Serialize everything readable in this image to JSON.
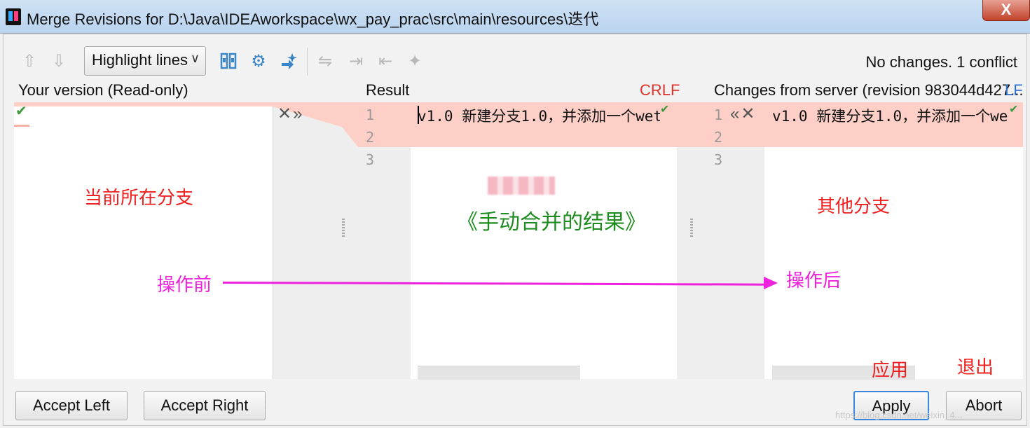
{
  "window": {
    "title": "Merge Revisions for D:\\Java\\IDEAworkspace\\wx_pay_prac\\src\\main\\resources\\迭代",
    "close_label": "X"
  },
  "toolbar": {
    "prev_icon": "arrow-up-icon",
    "next_icon": "arrow-down-icon",
    "highlight_mode": "Highlight lines",
    "status": "No changes. 1 conflict"
  },
  "headers": {
    "left": "Your version (Read-only)",
    "middle": "Result",
    "middle_line_sep": "CRLF",
    "right": "Changes from server (revision 983044d427...",
    "right_line_sep": "LF"
  },
  "editor": {
    "line_numbers": [
      "1",
      "2",
      "3"
    ],
    "result_line1": "v1.0  新建分支1.0，并添加一个wet",
    "server_line1": "v1.0  新建分支1.0，并添加一个we"
  },
  "annotations": {
    "current_branch": "当前所在分支",
    "manual_merge_result": "《手动合并的结果》",
    "other_branch": "其他分支",
    "before_op": "操作前",
    "after_op": "操作后",
    "apply_note": "应用",
    "exit_note": "退出"
  },
  "buttons": {
    "accept_left": "Accept Left",
    "accept_right": "Accept Right",
    "apply": "Apply",
    "abort": "Abort"
  },
  "watermark": "https://blog.csdn.net/weixin_4..."
}
